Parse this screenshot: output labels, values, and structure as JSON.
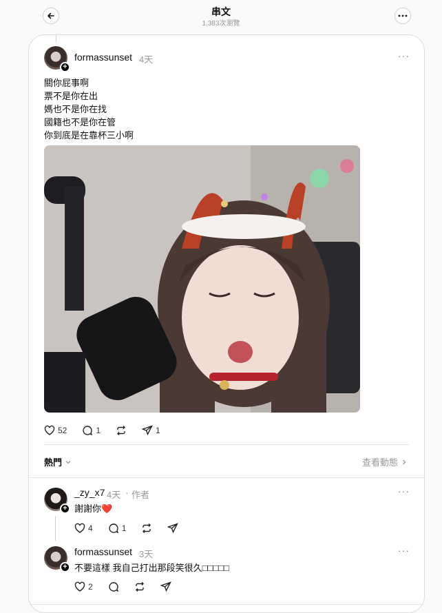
{
  "header": {
    "title": "串文",
    "views": "1,383次瀏覽"
  },
  "post": {
    "username": "formassunset",
    "time": "4天",
    "lines": [
      "關你屁事啊",
      "票不是你在出",
      "媽也不是你在找",
      "國籍也不是你在管",
      "你到底是在靠杯三小啊"
    ],
    "likes": "52",
    "comments": "1",
    "shares": "1"
  },
  "sort": {
    "label": "熱門",
    "activity_label": "查看動態"
  },
  "replies": [
    {
      "username": "_zy_x7",
      "time": "4天",
      "tag": "作者",
      "text": "謝謝你❤️",
      "likes": "4",
      "comments": "1"
    },
    {
      "username": "formassunset",
      "time": "3天",
      "text": "不要這樣 我自己打出那段笑很久□□□□□",
      "likes": "2"
    }
  ],
  "icons": [
    "back-arrow-icon",
    "more-icon",
    "heart-icon",
    "comment-icon",
    "repost-icon",
    "send-icon",
    "chevron-down-icon",
    "chevron-right-icon"
  ]
}
